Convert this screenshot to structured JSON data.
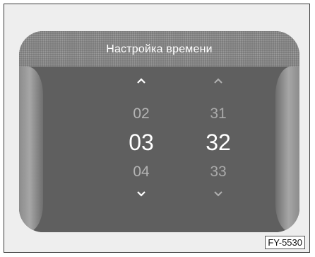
{
  "screen": {
    "title": "Настройка времени"
  },
  "hours": {
    "prev": "02",
    "current": "03",
    "next": "04"
  },
  "minutes": {
    "prev": "31",
    "current": "32",
    "next": "33"
  },
  "icons": {
    "up": "chevron-up-icon",
    "down": "chevron-down-icon"
  },
  "colors": {
    "arrow_active": "#ffffff",
    "arrow_inactive": "#b0b0b0",
    "current_value": "#ffffff",
    "adjacent_value": "#b4b4b4"
  },
  "figure_id": "FY-5530"
}
